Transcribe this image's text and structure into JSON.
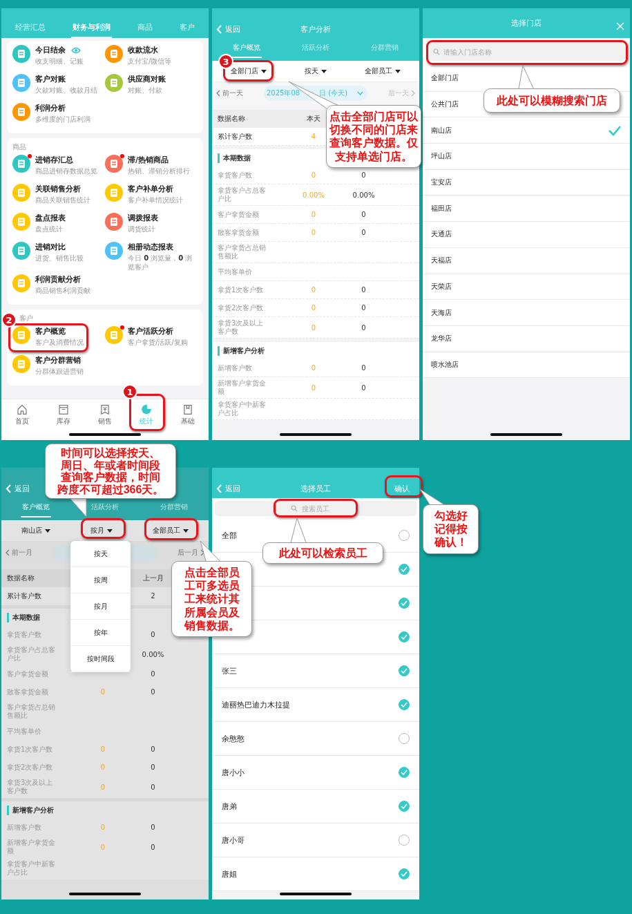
{
  "stats_screen": {
    "tabs": [
      {
        "label": "经营汇总",
        "selected": false
      },
      {
        "label": "财务与利润",
        "selected": true
      },
      {
        "label": "商品",
        "selected": false
      },
      {
        "label": "客户",
        "selected": false
      }
    ],
    "cards": [
      {
        "items": [
          {
            "name": "今日结余",
            "desc": "收支明细、记账",
            "color": "#2ec7c0",
            "eye": true
          },
          {
            "name": "收款流水",
            "desc": "支付宝/微信等",
            "color": "#ff9500"
          },
          {
            "name": "客户对账",
            "desc": "欠款对账、收款月结",
            "color": "#4fc3f7"
          },
          {
            "name": "供应商对账",
            "desc": "对账、付款",
            "color": "#a5c93a"
          },
          {
            "name": "利润分析",
            "desc": "多维度的门店利润",
            "color": "#ff9500"
          }
        ]
      },
      {
        "title": "商品",
        "items": [
          {
            "name": "进销存汇总",
            "desc": "商品进销存数据总览",
            "color": "#2ec7c0",
            "new_dot": true
          },
          {
            "name": "滞/热销商品",
            "desc": "热销、滞销分析排行",
            "color": "#fa6e5a",
            "new_dot": true
          },
          {
            "name": "关联销售分析",
            "desc": "商品关联销售统计",
            "color": "#ffc800"
          },
          {
            "name": "客户补单分析",
            "desc": "客户补单情况统计",
            "color": "#ffc800"
          },
          {
            "name": "盘点报表",
            "desc": "盘点统计",
            "color": "#ffc800"
          },
          {
            "name": "调拨报表",
            "desc": "调货统计",
            "color": "#fa6e5a"
          },
          {
            "name": "进销对比",
            "desc": "进货、销售比较",
            "color": "#2ec7c0"
          },
          {
            "name": "相册动态报表",
            "desc": "今日 **0** 浏览量，**0** 浏览客户",
            "color": "#4fc3f7"
          },
          {
            "name": "利润贡献分析",
            "desc": "商品销售利润贡献",
            "color": "#ffc800"
          }
        ]
      },
      {
        "title": "客户",
        "items": [
          {
            "name": "客户概览",
            "desc": "客户及消费情况",
            "color": "#ffc800"
          },
          {
            "name": "客户活跃分析",
            "desc": "客户拿货/活跃/复购",
            "color": "#ffc800",
            "new_dot": true
          },
          {
            "name": "客户分群营销",
            "desc": "分群体跟进营销",
            "color": "#ffc800"
          }
        ]
      }
    ],
    "nav": [
      {
        "label": "首页",
        "selected": false
      },
      {
        "label": "库存",
        "selected": false
      },
      {
        "label": "销售",
        "selected": false
      },
      {
        "label": "统计",
        "selected": true
      },
      {
        "label": "基础",
        "selected": false
      }
    ]
  },
  "customer_analysis_screen": {
    "back": "返回",
    "title": "客户分析",
    "tabs": [
      {
        "label": "客户概览",
        "selected": true
      },
      {
        "label": "活跃分析",
        "selected": false
      },
      {
        "label": "分群营销",
        "selected": false
      }
    ],
    "filters": [
      {
        "label": "全部门店"
      },
      {
        "label": "按天"
      },
      {
        "label": "全部员工"
      }
    ],
    "prev_link": "前一天",
    "date_parts": [
      "2025年08",
      "日 (今天)"
    ],
    "next_link": "后一天",
    "next_disabled": true,
    "columns": {
      "name": "数据名称",
      "current": "本天"
    },
    "rows": [
      {
        "kind": "total",
        "label": "累计客户数",
        "current": "4"
      },
      {
        "kind": "section",
        "label": "本期数据"
      },
      {
        "kind": "row",
        "label": "拿货客户数",
        "current": "0",
        "previous": "0"
      },
      {
        "kind": "row",
        "label": "拿货客户占总客户比",
        "current": "0.00%",
        "previous": "0.00%"
      },
      {
        "kind": "row",
        "label": "客户拿货金额",
        "current": "0",
        "previous": "0"
      },
      {
        "kind": "row",
        "label": "散客拿货金额",
        "current": "0",
        "previous": "0"
      },
      {
        "kind": "row",
        "label": "客户拿货占总销售额比"
      },
      {
        "kind": "row",
        "label": "平均客单价"
      },
      {
        "kind": "row",
        "label": "拿货1次客户数",
        "current": "0",
        "previous": "0"
      },
      {
        "kind": "row",
        "label": "拿货2次客户数",
        "current": "0",
        "previous": "0"
      },
      {
        "kind": "row",
        "label": "拿货3次及以上客户数",
        "current": "0",
        "previous": "0"
      },
      {
        "kind": "section",
        "label": "新增客户分析"
      },
      {
        "kind": "row",
        "label": "新增客户数",
        "current": "0",
        "previous": "0"
      },
      {
        "kind": "row",
        "label": "新增客户拿货金额",
        "current": "0",
        "previous": "0"
      },
      {
        "kind": "row",
        "label": "拿货客户中新客户占比"
      }
    ]
  },
  "store_picker_screen": {
    "title": "选择门店",
    "search": {
      "placeholder": "请输入门店名称"
    },
    "stores": [
      {
        "name": "全部门店",
        "selected": false
      },
      {
        "name": "公共门店",
        "selected": false
      },
      {
        "name": "南山店",
        "selected": true
      },
      {
        "name": "坪山店",
        "selected": false
      },
      {
        "name": "宝安店",
        "selected": false
      },
      {
        "name": "福田店",
        "selected": false
      },
      {
        "name": "天通店",
        "selected": false
      },
      {
        "name": "天福店",
        "selected": false
      },
      {
        "name": "天荣店",
        "selected": false
      },
      {
        "name": "天海店",
        "selected": false
      },
      {
        "name": "龙华店",
        "selected": false
      },
      {
        "name": "喷水池店",
        "selected": false
      }
    ]
  },
  "period_menu_screen": {
    "back": "返回",
    "tabs": [
      {
        "label": "客户概览",
        "selected": true
      },
      {
        "label": "活跃分析",
        "selected": false
      },
      {
        "label": "分群营销",
        "selected": false
      }
    ],
    "filters": [
      {
        "label": "南山店"
      },
      {
        "label": "按月"
      },
      {
        "label": "全部员工"
      }
    ],
    "prev_link": "前一月",
    "next_link": "后一月",
    "next_disabled": false,
    "columns": {
      "name": "数据名称",
      "previous": "上一月"
    },
    "rows": [
      {
        "kind": "total",
        "label": "累计客户数",
        "previous": "2"
      },
      {
        "kind": "section",
        "label": "本期数据"
      },
      {
        "kind": "row",
        "label": "拿货客户数",
        "previous": "0"
      },
      {
        "kind": "row",
        "label": "拿货客户占总客户比",
        "previous": "0.00%"
      },
      {
        "kind": "row",
        "label": "客户拿货金额",
        "previous": "0"
      },
      {
        "kind": "row",
        "label": "散客拿货金额",
        "current": "0",
        "previous": "0"
      },
      {
        "kind": "row",
        "label": "客户拿货占总销售额比"
      },
      {
        "kind": "row",
        "label": "平均客单价"
      },
      {
        "kind": "row",
        "label": "拿货1次客户数",
        "current": "0",
        "previous": "0"
      },
      {
        "kind": "row",
        "label": "拿货2次客户数",
        "current": "0",
        "previous": "0"
      },
      {
        "kind": "row",
        "label": "拿货3次及以上客户数",
        "current": "0",
        "previous": "0"
      },
      {
        "kind": "section",
        "label": "新增客户分析"
      },
      {
        "kind": "row",
        "label": "新增客户数",
        "current": "0",
        "previous": "0"
      },
      {
        "kind": "row",
        "label": "新增客户拿货金额",
        "current": "0",
        "previous": "0"
      },
      {
        "kind": "row",
        "label": "拿货客户中新客户占比"
      }
    ],
    "menu": {
      "options": [
        "按天",
        "按周",
        "按月",
        "按年",
        "按时间段"
      ]
    }
  },
  "staff_picker_screen": {
    "back": "返回",
    "title": "选择员工",
    "confirm": "确认",
    "search": {
      "placeholder": "搜索员工"
    },
    "staff": [
      {
        "name": "全部",
        "checked": false
      },
      {
        "checked": true
      },
      {
        "checked": true
      },
      {
        "checked": true
      },
      {
        "name": "张三",
        "checked": true
      },
      {
        "name": "迪丽热巴迪力木拉提",
        "checked": true
      },
      {
        "name": "余憨憨",
        "checked": false
      },
      {
        "name": "唐小小",
        "checked": true
      },
      {
        "name": "唐弟",
        "checked": true
      },
      {
        "name": "唐小哥",
        "checked": false
      },
      {
        "name": "唐姐",
        "checked": true
      }
    ]
  },
  "annotations": [
    {
      "kind": "ring",
      "number": "1"
    },
    {
      "kind": "ring",
      "number": "2"
    },
    {
      "kind": "ring",
      "number": "3"
    },
    {
      "kind": "ring"
    },
    {
      "kind": "ring"
    },
    {
      "kind": "ring"
    },
    {
      "kind": "ring"
    },
    {
      "kind": "ring"
    },
    {
      "kind": "callout",
      "text": "点击全部门店可以切换不同的门店来查询客户数据。仅支持单选门店。"
    },
    {
      "kind": "callout",
      "text": "此处可以模糊搜索门店"
    },
    {
      "kind": "callout",
      "text": "时间可以选择按天、周日、年或者时间段查询客户数据，时间跨度不可超过366天。"
    },
    {
      "kind": "callout",
      "text": "点击全部员工可多选员工来统计其所属会员及销售数据。"
    },
    {
      "kind": "callout",
      "text": "此处可以检索员工"
    },
    {
      "kind": "callout",
      "text": "勾选好记得按确认！"
    }
  ]
}
